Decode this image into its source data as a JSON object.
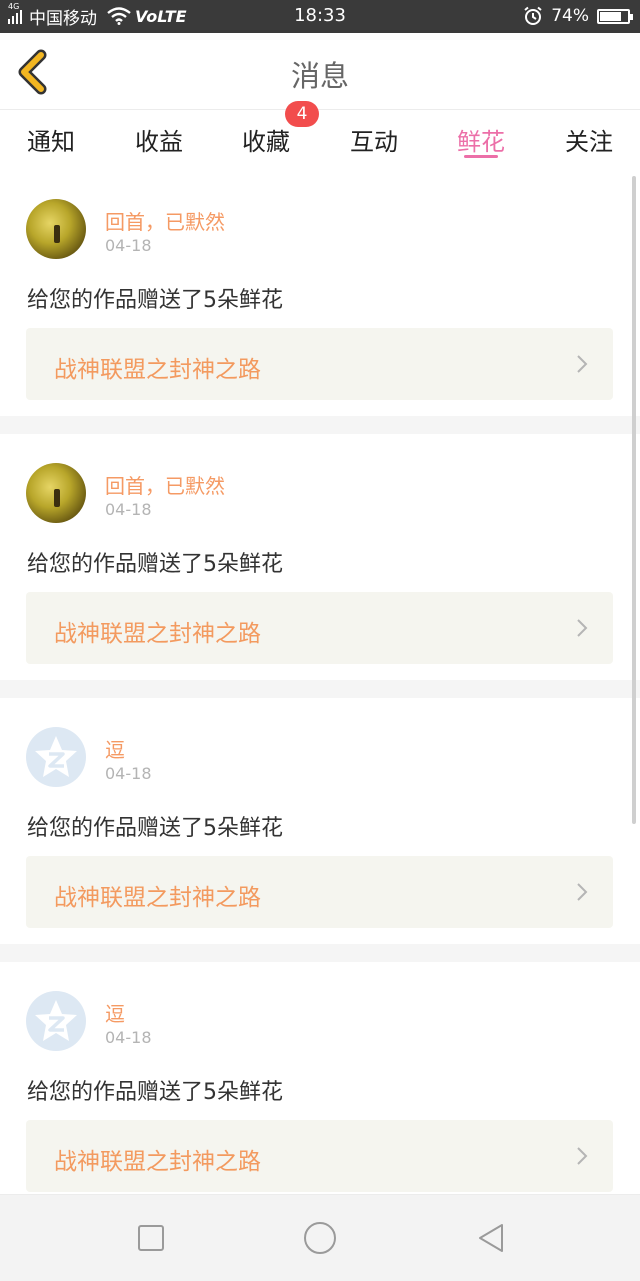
{
  "status_bar": {
    "network_type": "4G",
    "carrier": "中国移动",
    "volte": "VoLTE",
    "time": "18:33",
    "battery": "74%",
    "battery_level": 0.74
  },
  "header": {
    "title": "消息",
    "back_icon": "chevron-left-icon",
    "accent_color": "#f2b622"
  },
  "tabs": [
    {
      "label": "通知"
    },
    {
      "label": "收益"
    },
    {
      "label": "收藏",
      "badge": "4"
    },
    {
      "label": "互动"
    },
    {
      "label": "鲜花",
      "active": true
    },
    {
      "label": "关注"
    }
  ],
  "messages": [
    {
      "user": "回首，已默然",
      "date": "04-18",
      "text": "给您的作品赠送了5朵鲜花",
      "work": "战神联盟之封神之路",
      "avatar": "photo"
    },
    {
      "user": "回首，已默然",
      "date": "04-18",
      "text": "给您的作品赠送了5朵鲜花",
      "work": "战神联盟之封神之路",
      "avatar": "photo"
    },
    {
      "user": "逗",
      "date": "04-18",
      "text": "给您的作品赠送了5朵鲜花",
      "work": "战神联盟之封神之路",
      "avatar": "default"
    },
    {
      "user": "逗",
      "date": "04-18",
      "text": "给您的作品赠送了5朵鲜花",
      "work": "战神联盟之封神之路",
      "avatar": "default"
    }
  ],
  "colors": {
    "active_tab": "#ec6fa8",
    "username": "#f59a64",
    "work_title": "#f39a5f",
    "badge": "#f24d4d"
  },
  "nav": {
    "recent_icon": "square-icon",
    "home_icon": "circle-icon",
    "back_icon": "triangle-back-icon"
  }
}
